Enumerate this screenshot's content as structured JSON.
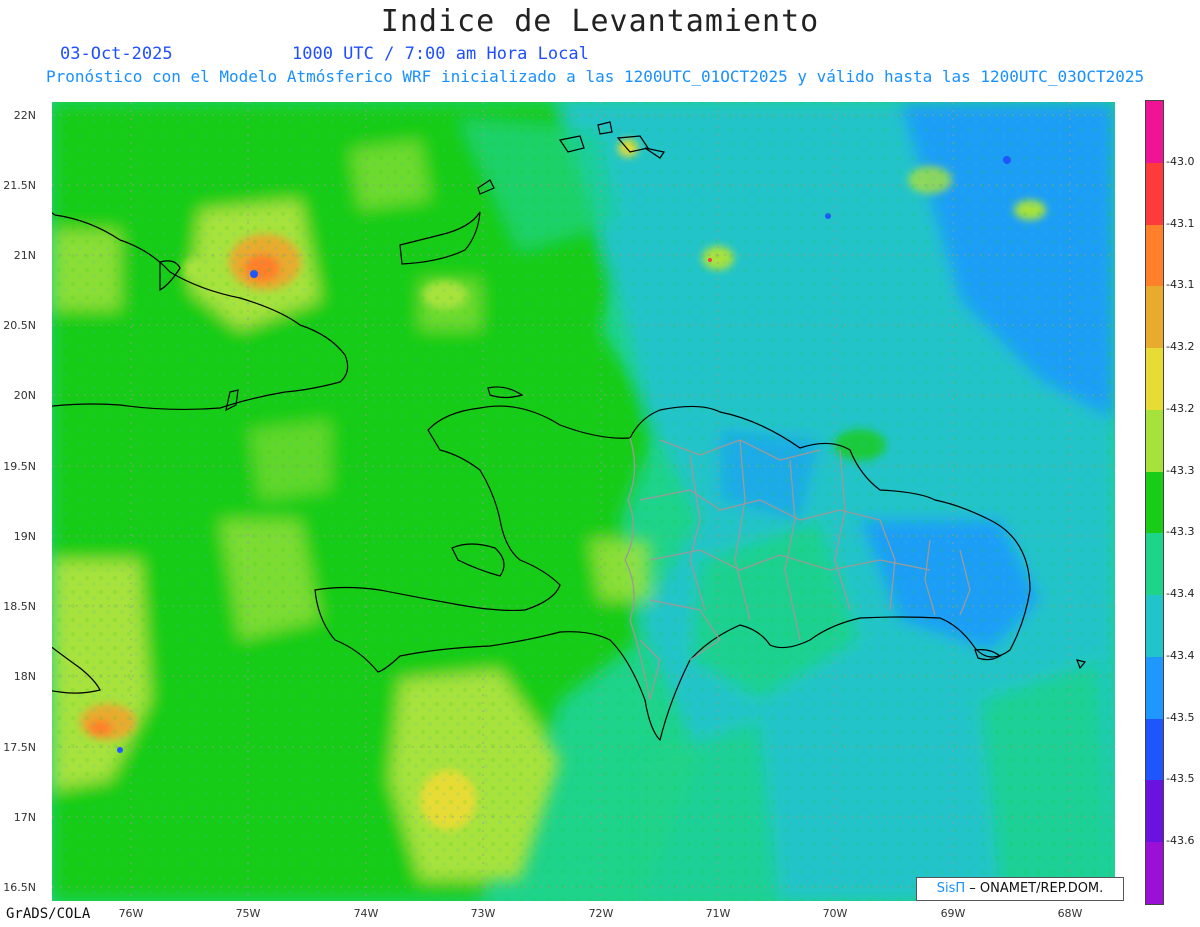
{
  "title": "Indice de Levantamiento",
  "date": "03-Oct-2025",
  "time": "1000 UTC / 7:00 am Hora Local",
  "forecast": "Pronóstico con el Modelo Atmósferico WRF inicializado a las 1200UTC_01OCT2025 y válido hasta las  1200UTC_03OCT2025",
  "map": {
    "lat_labels": [
      "22N",
      "21.5N",
      "21N",
      "20.5N",
      "20N",
      "19.5N",
      "19N",
      "18.5N",
      "18N",
      "17.5N",
      "17N",
      "16.5N"
    ],
    "lon_labels": [
      "76W",
      "75W",
      "74W",
      "73W",
      "72W",
      "71W",
      "70W",
      "69W",
      "68W"
    ],
    "regions": [
      "Cuba",
      "Haiti",
      "Dominican Republic",
      "Bahamas",
      "Turks and Caicos",
      "Jamaica"
    ]
  },
  "colorbar": {
    "colors": [
      "#ee1493",
      "#ff3a3a",
      "#ff7f2a",
      "#e8ab2e",
      "#e6dc35",
      "#a7e23c",
      "#18cc18",
      "#1ed38a",
      "#21c4c9",
      "#1e98ff",
      "#1e55ff",
      "#6a13e0",
      "#9a10d6"
    ],
    "labels": [
      "-43.0",
      "-43.1",
      "-43.1",
      "-43.2",
      "-43.2",
      "-43.3",
      "-43.3",
      "-43.4",
      "-43.4",
      "-43.5",
      "-43.5",
      "-43.6"
    ]
  },
  "credit": {
    "logo": "SisΠ",
    "text": "– ONAMET/REP.DOM."
  },
  "software": "GrADS/COLA"
}
